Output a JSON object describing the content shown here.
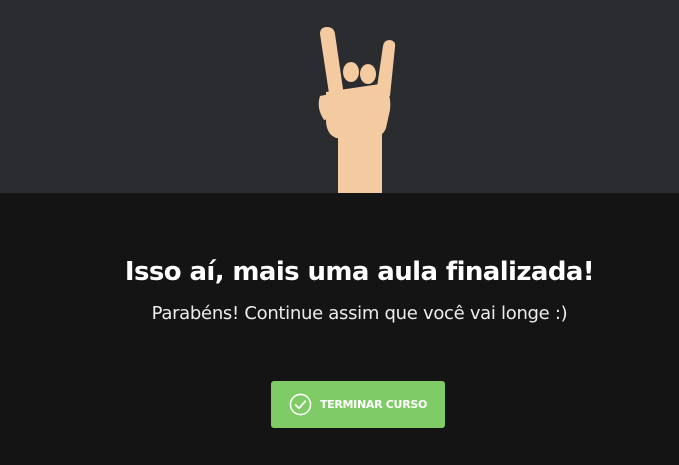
{
  "hero": {
    "illustration": "rock-on-hand-icon",
    "colors": {
      "background": "#2a2c2f",
      "skin": "#f4cba0"
    }
  },
  "message": {
    "title": "Isso aí, mais uma aula finalizada!",
    "subtitle": "Parabéns! Continue assim que você vai longe :)"
  },
  "actions": {
    "finish_label": "TERMINAR CURSO",
    "finish_icon": "check-circle-icon",
    "finish_color": "#7fcc66"
  }
}
